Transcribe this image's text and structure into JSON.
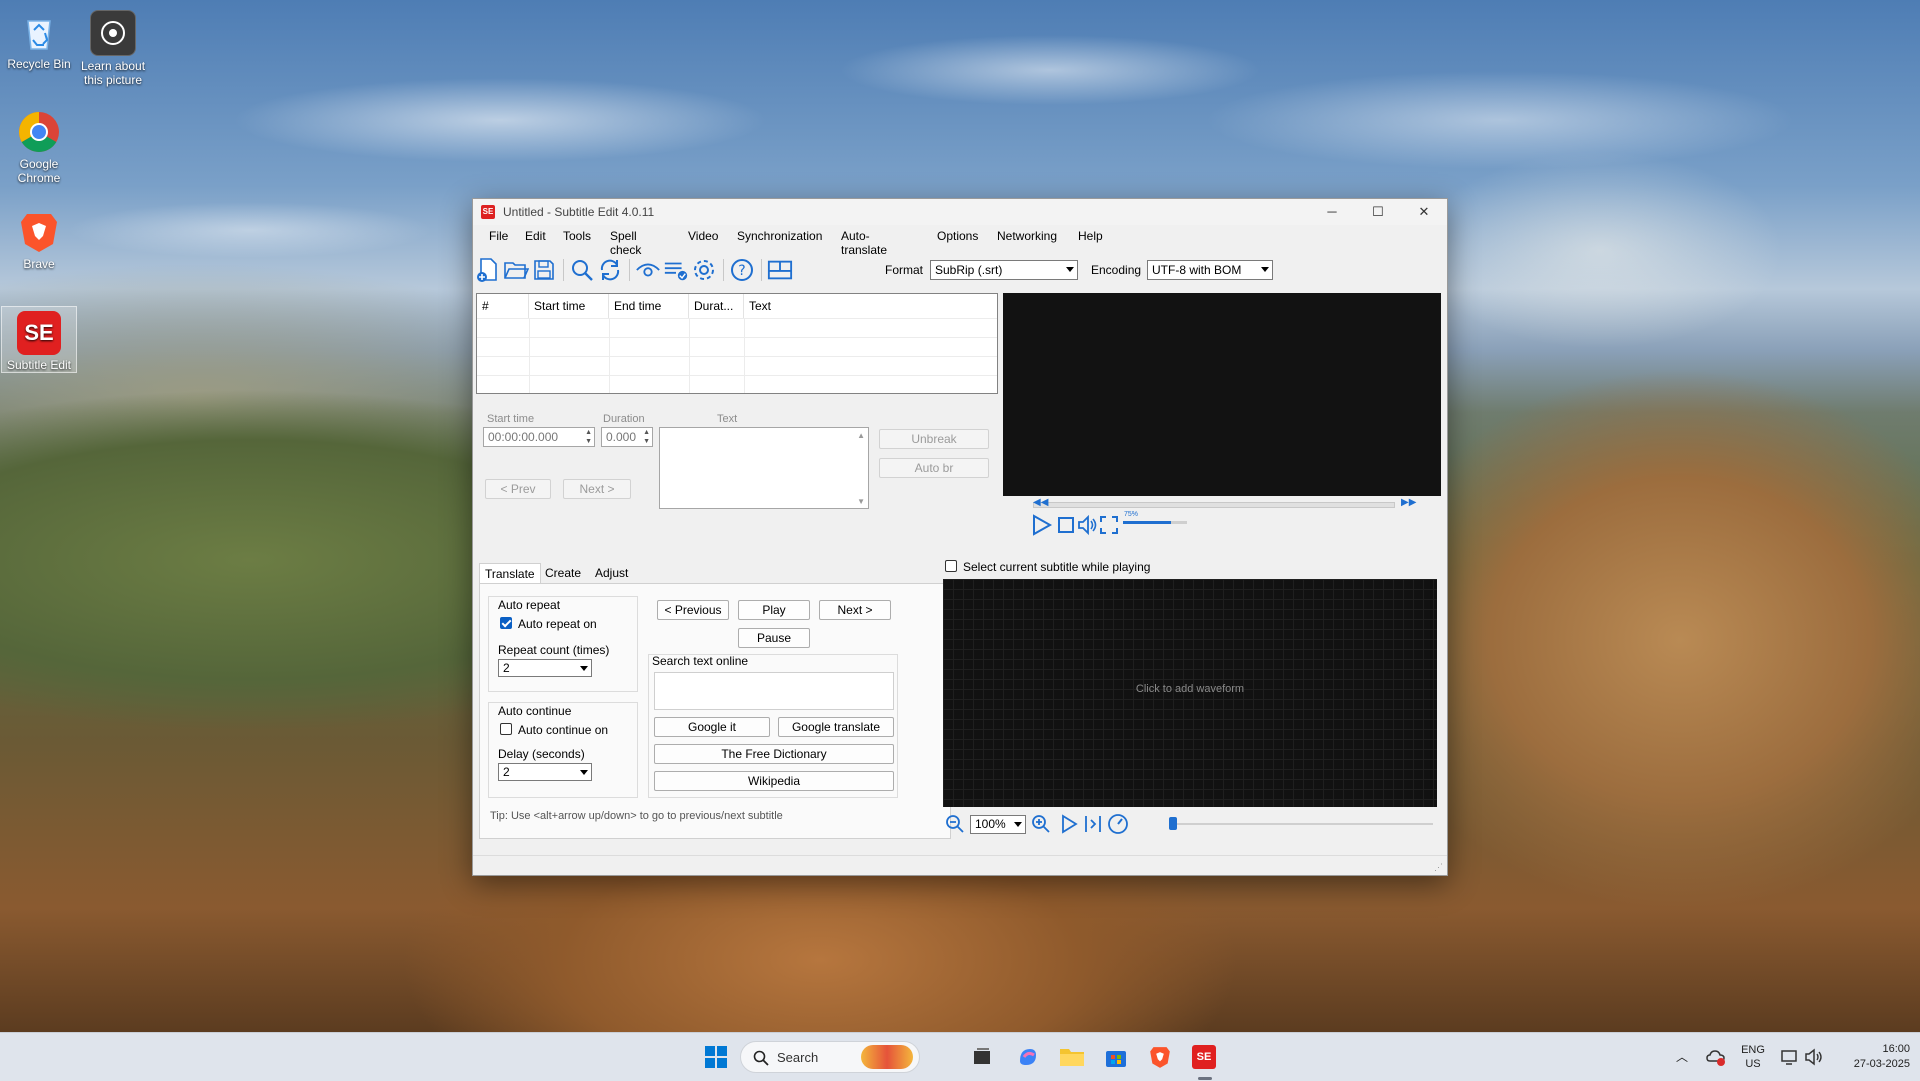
{
  "desktop": {
    "icons": [
      {
        "label": "Recycle Bin"
      },
      {
        "label": "Learn about this picture"
      },
      {
        "label": "Google Chrome"
      },
      {
        "label": "Brave"
      },
      {
        "label": "Subtitle Edit"
      }
    ]
  },
  "window": {
    "title": "Untitled - Subtitle Edit 4.0.11",
    "logo_text": "SE",
    "controls": {
      "minimize": "─",
      "maximize": "☐",
      "close": "✕"
    }
  },
  "menu": [
    "File",
    "Edit",
    "Tools",
    "Spell check",
    "Video",
    "Synchronization",
    "Auto-translate",
    "Options",
    "Networking",
    "Help"
  ],
  "toolbar": {
    "format_label": "Format",
    "format_value": "SubRip (.srt)",
    "encoding_label": "Encoding",
    "encoding_value": "UTF-8 with BOM"
  },
  "grid": {
    "columns": [
      "#",
      "Start time",
      "End time",
      "Durat...",
      "Text"
    ]
  },
  "editor": {
    "start_time_label": "Start time",
    "start_time_value": "00:00:00.000",
    "duration_label": "Duration",
    "duration_value": "0.000",
    "text_label": "Text",
    "prev_label": "< Prev",
    "next_label": "Next >",
    "unbreak_label": "Unbreak",
    "auto_br_label": "Auto br"
  },
  "player": {
    "volume_text": "75%",
    "volume_level": 0.75
  },
  "tabs": [
    "Translate",
    "Create",
    "Adjust"
  ],
  "translate": {
    "auto_repeat_group": "Auto repeat",
    "auto_repeat_on": "Auto repeat on",
    "repeat_count_label": "Repeat count (times)",
    "repeat_count_value": "2",
    "auto_continue_group": "Auto continue",
    "auto_continue_on": "Auto continue on",
    "delay_label": "Delay (seconds)",
    "delay_value": "2",
    "previous_label": "< Previous",
    "play_label": "Play",
    "next_label": "Next >",
    "pause_label": "Pause",
    "search_label": "Search text online",
    "google_it": "Google it",
    "google_translate": "Google translate",
    "free_dictionary": "The Free Dictionary",
    "wikipedia": "Wikipedia",
    "tip": "Tip: Use <alt+arrow up/down> to go to previous/next subtitle"
  },
  "waveform": {
    "select_current_label": "Select current subtitle while playing",
    "click_to_add": "Click to add waveform",
    "zoom_value": "100%"
  },
  "taskbar": {
    "search_placeholder": "Search",
    "lang_line1": "ENG",
    "lang_line2": "US",
    "time": "16:00",
    "date": "27-03-2025"
  }
}
